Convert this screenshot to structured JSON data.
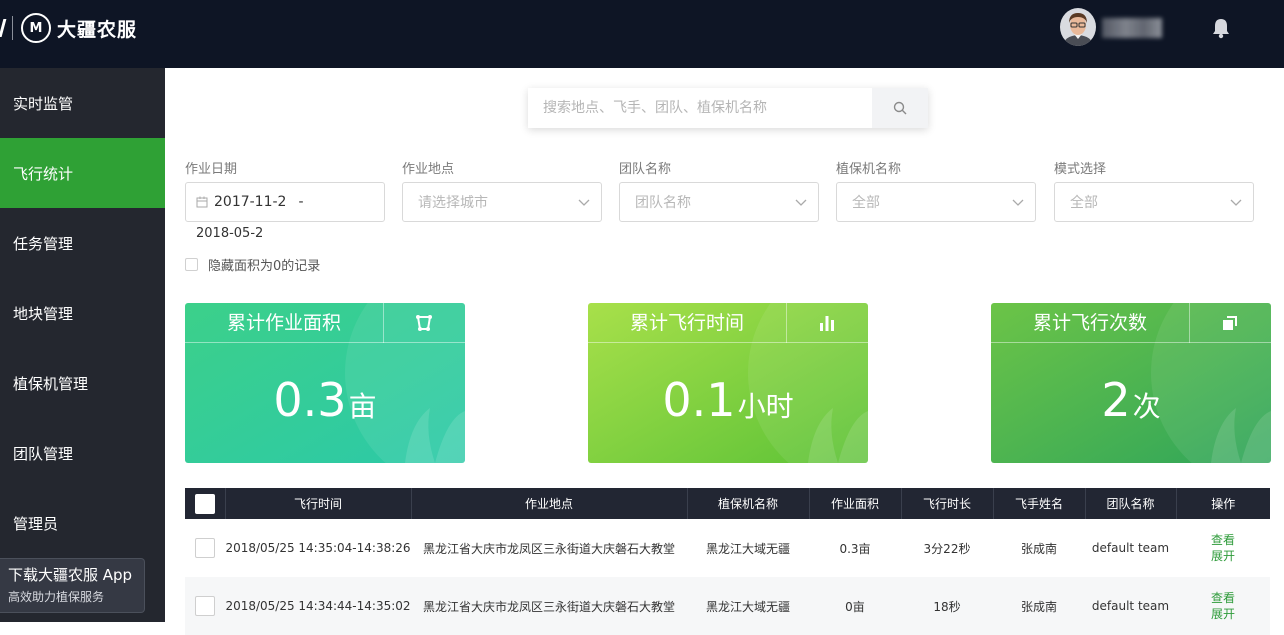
{
  "header": {
    "brand_logo_text": "M",
    "brand_name": "大疆农服",
    "icons": [
      "avatar",
      "bell-icon"
    ]
  },
  "sidebar": {
    "items": [
      {
        "label": "实时监管",
        "active": false
      },
      {
        "label": "飞行统计",
        "active": true
      },
      {
        "label": "任务管理",
        "active": false
      },
      {
        "label": "地块管理",
        "active": false
      },
      {
        "label": "植保机管理",
        "active": false
      },
      {
        "label": "团队管理",
        "active": false
      },
      {
        "label": "管理员",
        "active": false
      }
    ],
    "app_banner": {
      "title": "下载大疆农服 App",
      "subtitle": "高效助力植保服务"
    }
  },
  "search": {
    "placeholder": "搜索地点、飞手、团队、植保机名称",
    "icon": "search-icon"
  },
  "filters": {
    "date": {
      "label": "作业日期",
      "start": "2017-11-2",
      "separator": "-",
      "end": "2018-05-2"
    },
    "location": {
      "label": "作业地点",
      "placeholder": "请选择城市"
    },
    "team": {
      "label": "团队名称",
      "placeholder": "团队名称"
    },
    "drone": {
      "label": "植保机名称",
      "value": "全部"
    },
    "mode": {
      "label": "模式选择",
      "value": "全部"
    },
    "hide_zero_label": "隐藏面积为0的记录"
  },
  "stats": [
    {
      "title": "累计作业面积",
      "value": "0.3",
      "unit": "亩",
      "icon": "area-icon",
      "color_from": "#3cd08a",
      "color_to": "#2cc9a8"
    },
    {
      "title": "累计飞行时间",
      "value": "0.1",
      "unit": "小时",
      "icon": "bar-chart-icon",
      "color_from": "#a8e04a",
      "color_to": "#5cc237"
    },
    {
      "title": "累计飞行次数",
      "value": "2",
      "unit": "次",
      "icon": "copy-icon",
      "color_from": "#6cc447",
      "color_to": "#2fa55a"
    }
  ],
  "table": {
    "columns": [
      "飞行时间",
      "作业地点",
      "植保机名称",
      "作业面积",
      "飞行时长",
      "飞手姓名",
      "团队名称",
      "操作"
    ],
    "rows": [
      {
        "time": "2018/05/25 14:35:04-14:38:26",
        "location": "黑龙江省大庆市龙凤区三永街道大庆磐石大教堂",
        "drone": "黑龙江大域无疆",
        "area": "0.3亩",
        "duration": "3分22秒",
        "pilot": "张成南",
        "team": "default team",
        "view": "查看",
        "expand": "展开"
      },
      {
        "time": "2018/05/25 14:34:44-14:35:02",
        "location": "黑龙江省大庆市龙凤区三永街道大庆磐石大教堂",
        "drone": "黑龙江大域无疆",
        "area": "0亩",
        "duration": "18秒",
        "pilot": "张成南",
        "team": "default team",
        "view": "查看",
        "expand": "展开"
      }
    ]
  },
  "colors": {
    "topbar": "#0e1525",
    "sidebar": "#24272f",
    "active": "#2fa135",
    "link": "#2e9b3a"
  }
}
